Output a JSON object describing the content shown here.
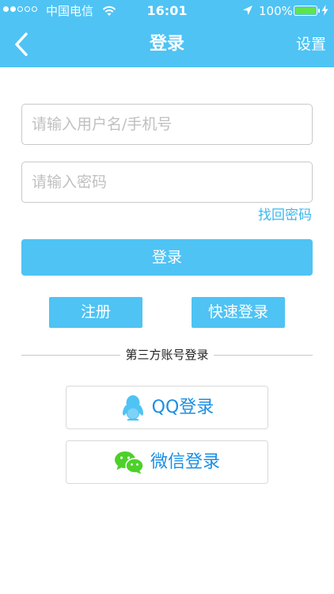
{
  "status_bar": {
    "carrier": "中国电信",
    "time": "16:01",
    "battery": "100%"
  },
  "nav": {
    "title": "登录",
    "settings": "设置"
  },
  "form": {
    "username_placeholder": "请输入用户名/手机号",
    "password_placeholder": "请输入密码",
    "forgot_password": "找回密码",
    "login_button": "登录"
  },
  "actions": {
    "register": "注册",
    "quick_login": "快速登录"
  },
  "third_party": {
    "label": "第三方账号登录",
    "qq": "QQ登录",
    "wechat": "微信登录"
  },
  "colors": {
    "accent": "#4fc3f4",
    "link": "#3db7ee",
    "social_text": "#1a8fe3",
    "wechat_green": "#4cd12a",
    "qq_blue": "#4fc3f4"
  },
  "icons": {
    "back": "chevron-left-icon",
    "wifi": "wifi-icon",
    "location": "location-arrow-icon",
    "battery": "battery-icon",
    "qq": "qq-penguin-icon",
    "wechat": "wechat-icon"
  }
}
